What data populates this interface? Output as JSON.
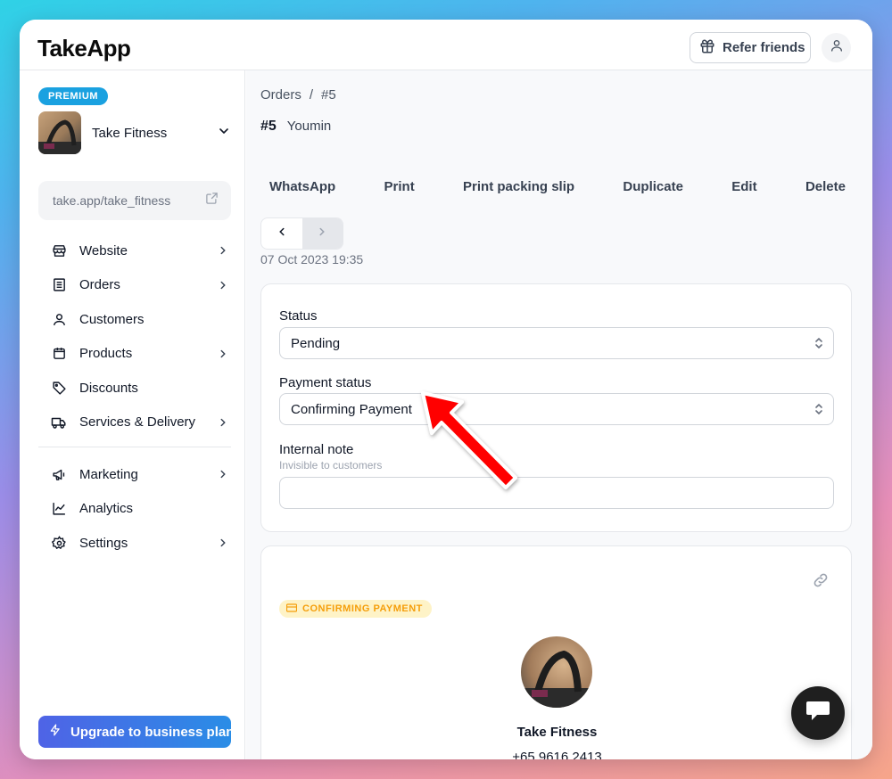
{
  "app": {
    "logo": "TakeApp"
  },
  "header": {
    "refer_label": "Refer friends",
    "gift_icon": "gift-icon",
    "user_icon": "user-icon"
  },
  "sidebar": {
    "plan_badge": "PREMIUM",
    "store_name": "Take Fitness",
    "store_link": "take.app/take_fitness",
    "nav": [
      {
        "label": "Website",
        "icon": "store-icon",
        "has_chevron": true
      },
      {
        "label": "Orders",
        "icon": "orders-icon",
        "has_chevron": true
      },
      {
        "label": "Customers",
        "icon": "person-icon",
        "has_chevron": false
      },
      {
        "label": "Products",
        "icon": "box-icon",
        "has_chevron": true
      },
      {
        "label": "Discounts",
        "icon": "tag-icon",
        "has_chevron": false
      },
      {
        "label": "Services & Delivery",
        "icon": "truck-icon",
        "has_chevron": true
      }
    ],
    "nav2": [
      {
        "label": "Marketing",
        "icon": "megaphone-icon",
        "has_chevron": true
      },
      {
        "label": "Analytics",
        "icon": "chart-icon",
        "has_chevron": false
      },
      {
        "label": "Settings",
        "icon": "gear-icon",
        "has_chevron": true
      }
    ],
    "upgrade_label": "Upgrade to business plan"
  },
  "main": {
    "breadcrumb": {
      "root": "Orders",
      "sep": "/",
      "current": "#5"
    },
    "order": {
      "number": "#5",
      "customer": "Youmin",
      "date": "07 Oct 2023 19:35"
    },
    "actions": [
      "WhatsApp",
      "Print",
      "Print packing slip",
      "Duplicate",
      "Edit",
      "Delete"
    ],
    "form": {
      "status_label": "Status",
      "status_value": "Pending",
      "payment_label": "Payment status",
      "payment_value": "Confirming Payment",
      "note_label": "Internal note",
      "note_sub": "Invisible to customers",
      "note_value": ""
    },
    "invoice": {
      "badge": "CONFIRMING PAYMENT",
      "shop_name": "Take Fitness",
      "phone": "+65 9616 2413"
    }
  },
  "colors": {
    "accent": "#1aa1e0",
    "badge_bg": "#fef3c7",
    "badge_text": "#f59e0b",
    "arrow": "#ff0000"
  }
}
